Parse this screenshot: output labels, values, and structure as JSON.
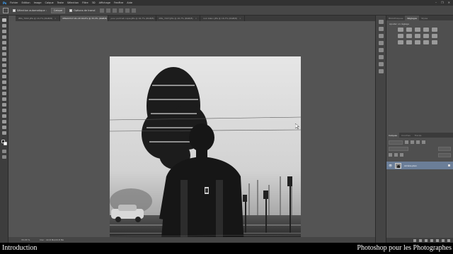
{
  "menubar": {
    "logo": "Ps",
    "items": [
      "Fichier",
      "Edition",
      "Image",
      "Calque",
      "Texte",
      "Sélection",
      "Filtre",
      "3D",
      "Affichage",
      "Fenêtre",
      "Aide"
    ],
    "controls": [
      "–",
      "❐",
      "✕"
    ]
  },
  "options": {
    "auto_select_label": "Sélection automatique :",
    "auto_select_value": "Calque",
    "transform_label": "Options de transf."
  },
  "tabs": [
    {
      "label": "IMG_7002.JPG @ 16,7% (RGB/8)",
      "active": false
    },
    {
      "label": "IMG02317-01-18 16,6% @ 33,3% (RGB/8)",
      "active": true
    },
    {
      "label": "pour portrait copie.JPG @ 16,7% (RGB/8)",
      "active": false
    },
    {
      "label": "IMG_7227.JPG @ 16,7% (RGB/8)",
      "active": false
    },
    {
      "label": "noir blanc.JPG @ 16,7% (RGB/8)",
      "active": false
    }
  ],
  "status": {
    "zoom": "33,33 %",
    "doc": "Doc : 22,8 Mo/22,8 Mo"
  },
  "right_panel": {
    "top_tabs": [
      "Bibliothèques",
      "Réglages",
      "Styles"
    ],
    "active_top_tab": "Réglages",
    "adjust_label": "Ajouter un réglage",
    "layer_tabs": [
      "Calques",
      "Couches",
      "Tracés"
    ],
    "layer_name": "Arrière-plan"
  },
  "caption": {
    "left": "Introduction",
    "right": "Photoshop pour les Photographes"
  }
}
